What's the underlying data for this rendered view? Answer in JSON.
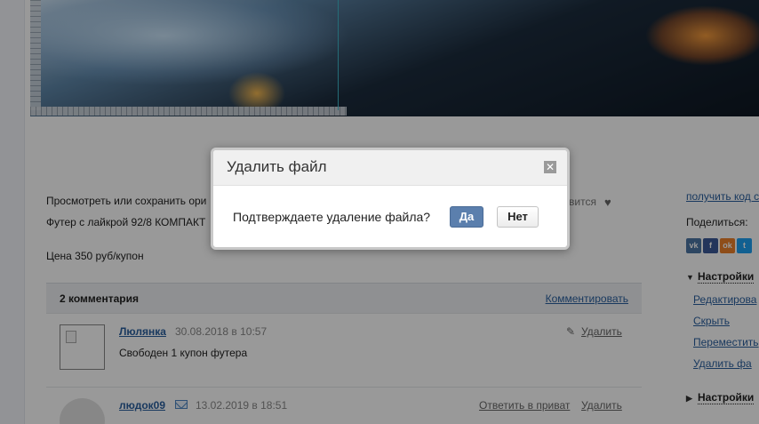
{
  "content": {
    "description_line1": "Просмотреть или сохранить ори",
    "description_line2": "Футер с лайкрой 92/8 КОМПАКТ",
    "price": "Цена 350 руб/купон",
    "like_text": "вится"
  },
  "comments": {
    "count_label": "2 комментария",
    "add_link": "Комментировать",
    "items": [
      {
        "author": "Люлянка",
        "date": "30.08.2018 в 10:57",
        "text": "Свободен 1 купон футера",
        "delete": "Удалить"
      },
      {
        "author": "людок09",
        "date": "13.02.2019 в 18:51",
        "reply_private": "Ответить в приват",
        "delete": "Удалить"
      }
    ]
  },
  "sidebar": {
    "get_code": "получить код с",
    "share_label": "Поделиться:",
    "social": [
      {
        "icon": "vk-icon",
        "glyph": "vk",
        "color": "#4c75a3"
      },
      {
        "icon": "facebook-icon",
        "glyph": "f",
        "color": "#3b5998"
      },
      {
        "icon": "odnoklassniki-icon",
        "glyph": "ok",
        "color": "#ed812b"
      },
      {
        "icon": "twitter-icon",
        "glyph": "t",
        "color": "#1da1f2"
      }
    ],
    "settings1": "Настройки",
    "settings1_items": [
      "Редактирова",
      "Скрыть",
      "Переместить",
      "Удалить фа"
    ],
    "settings2": "Настройки"
  },
  "dialog": {
    "title": "Удалить файл",
    "message": "Подтверждаете удаление файла?",
    "yes_label": "Да",
    "no_label": "Нет",
    "close_glyph": "✕"
  }
}
